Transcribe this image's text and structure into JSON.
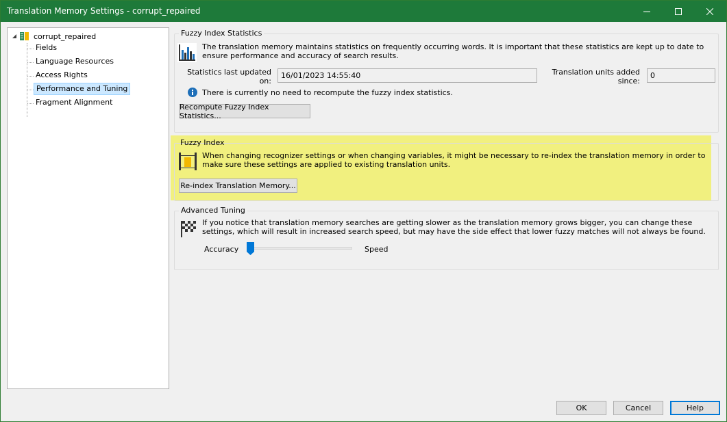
{
  "window": {
    "title": "Translation Memory Settings - corrupt_repaired"
  },
  "tree": {
    "root": "corrupt_repaired",
    "items": [
      {
        "label": "Fields"
      },
      {
        "label": "Language Resources"
      },
      {
        "label": "Access Rights"
      },
      {
        "label": "Performance and Tuning",
        "selected": true
      },
      {
        "label": "Fragment Alignment"
      }
    ]
  },
  "fuzzy_stats": {
    "title": "Fuzzy Index Statistics",
    "description": "The translation memory maintains statistics on frequently occurring words. It is important that these statistics are kept up to date to ensure performance and accuracy of search results.",
    "last_updated_label": "Statistics last updated on:",
    "last_updated_value": "16/01/2023 14:55:40",
    "units_added_label": "Translation units added since:",
    "units_added_value": "0",
    "info_text": "There is currently no need to recompute the fuzzy index statistics.",
    "recompute_button": "Recompute Fuzzy Index Statistics..."
  },
  "fuzzy_index": {
    "title": "Fuzzy Index",
    "description": "When changing recognizer settings or when changing variables, it might be necessary to re-index the translation memory in order to make sure these settings are applied to existing translation units.",
    "reindex_button": "Re-index Translation Memory..."
  },
  "advanced": {
    "title": "Advanced Tuning",
    "description": "If you notice that translation memory searches are getting slower as the translation memory grows bigger, you can change these settings, which will result in increased search speed, but may have the side effect that lower fuzzy matches will not always be found.",
    "left_label": "Accuracy",
    "right_label": "Speed",
    "slider_value": 0
  },
  "footer": {
    "ok": "OK",
    "cancel": "Cancel",
    "help": "Help"
  },
  "colors": {
    "titlebar": "#1e7a3a",
    "highlight": "#f0ef78",
    "selection": "#cce8ff",
    "accent": "#0078d7"
  }
}
